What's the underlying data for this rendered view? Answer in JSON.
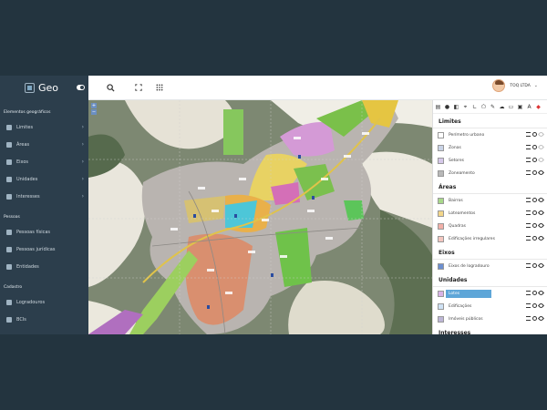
{
  "app": {
    "name": "Geo"
  },
  "sidebar": {
    "sections": [
      {
        "title": "Elementos geográficos",
        "items": [
          {
            "label": "Limites",
            "icon": "grid-icon",
            "has_submenu": true
          },
          {
            "label": "Áreas",
            "icon": "area-icon",
            "has_submenu": true
          },
          {
            "label": "Eixos",
            "icon": "road-icon",
            "has_submenu": true
          },
          {
            "label": "Unidades",
            "icon": "pin-icon",
            "has_submenu": true
          },
          {
            "label": "Interesses",
            "icon": "star-icon",
            "has_submenu": true
          }
        ]
      },
      {
        "title": "Pessoas",
        "items": [
          {
            "label": "Pessoas físicas",
            "icon": "person-icon"
          },
          {
            "label": "Pessoas jurídicas",
            "icon": "people-icon"
          },
          {
            "label": "Entidades",
            "icon": "building-icon"
          }
        ]
      },
      {
        "title": "Cadastro",
        "items": [
          {
            "label": "Logradouros",
            "icon": "road-icon"
          },
          {
            "label": "BCIs",
            "icon": "list-icon"
          }
        ]
      }
    ]
  },
  "topbar": {
    "icons": [
      "search-icon",
      "fullscreen-icon",
      "apps-grid-icon"
    ],
    "user_name": "TOQ LTDA"
  },
  "layers": {
    "groups": [
      {
        "title": "Limites",
        "items": [
          {
            "label": "Perímetro urbano",
            "color": "#ffffff",
            "visible": false
          },
          {
            "label": "Zonas",
            "color": "#c9d3e6",
            "visible": false
          },
          {
            "label": "Setores",
            "color": "#d6c9ea",
            "visible": false
          },
          {
            "label": "Zoneamento",
            "color": "#b8b8b8",
            "visible": true
          }
        ]
      },
      {
        "title": "Áreas",
        "items": [
          {
            "label": "Bairros",
            "color": "#a8d88a",
            "visible": true
          },
          {
            "label": "Loteamentos",
            "color": "#f3d68a",
            "visible": true
          },
          {
            "label": "Quadras",
            "color": "#f2b0a8",
            "visible": true
          },
          {
            "label": "Edificações irregulares",
            "color": "#f4c7c0",
            "visible": true
          }
        ]
      },
      {
        "title": "Eixos",
        "items": [
          {
            "label": "Eixos de logradouro",
            "color": "#6c8fd0",
            "visible": true
          }
        ]
      },
      {
        "title": "Unidades",
        "items": [
          {
            "label": "Lotes",
            "color": "#d9b3e6",
            "visible": true,
            "active": true
          },
          {
            "label": "Edificações",
            "color": "#cfe2f5",
            "visible": true
          },
          {
            "label": "Imóveis públicos",
            "color": "#bdb6d6",
            "visible": true
          }
        ]
      },
      {
        "title": "Interesses",
        "items": []
      }
    ]
  },
  "map": {
    "zoom_in": "+",
    "zoom_out": "−"
  }
}
